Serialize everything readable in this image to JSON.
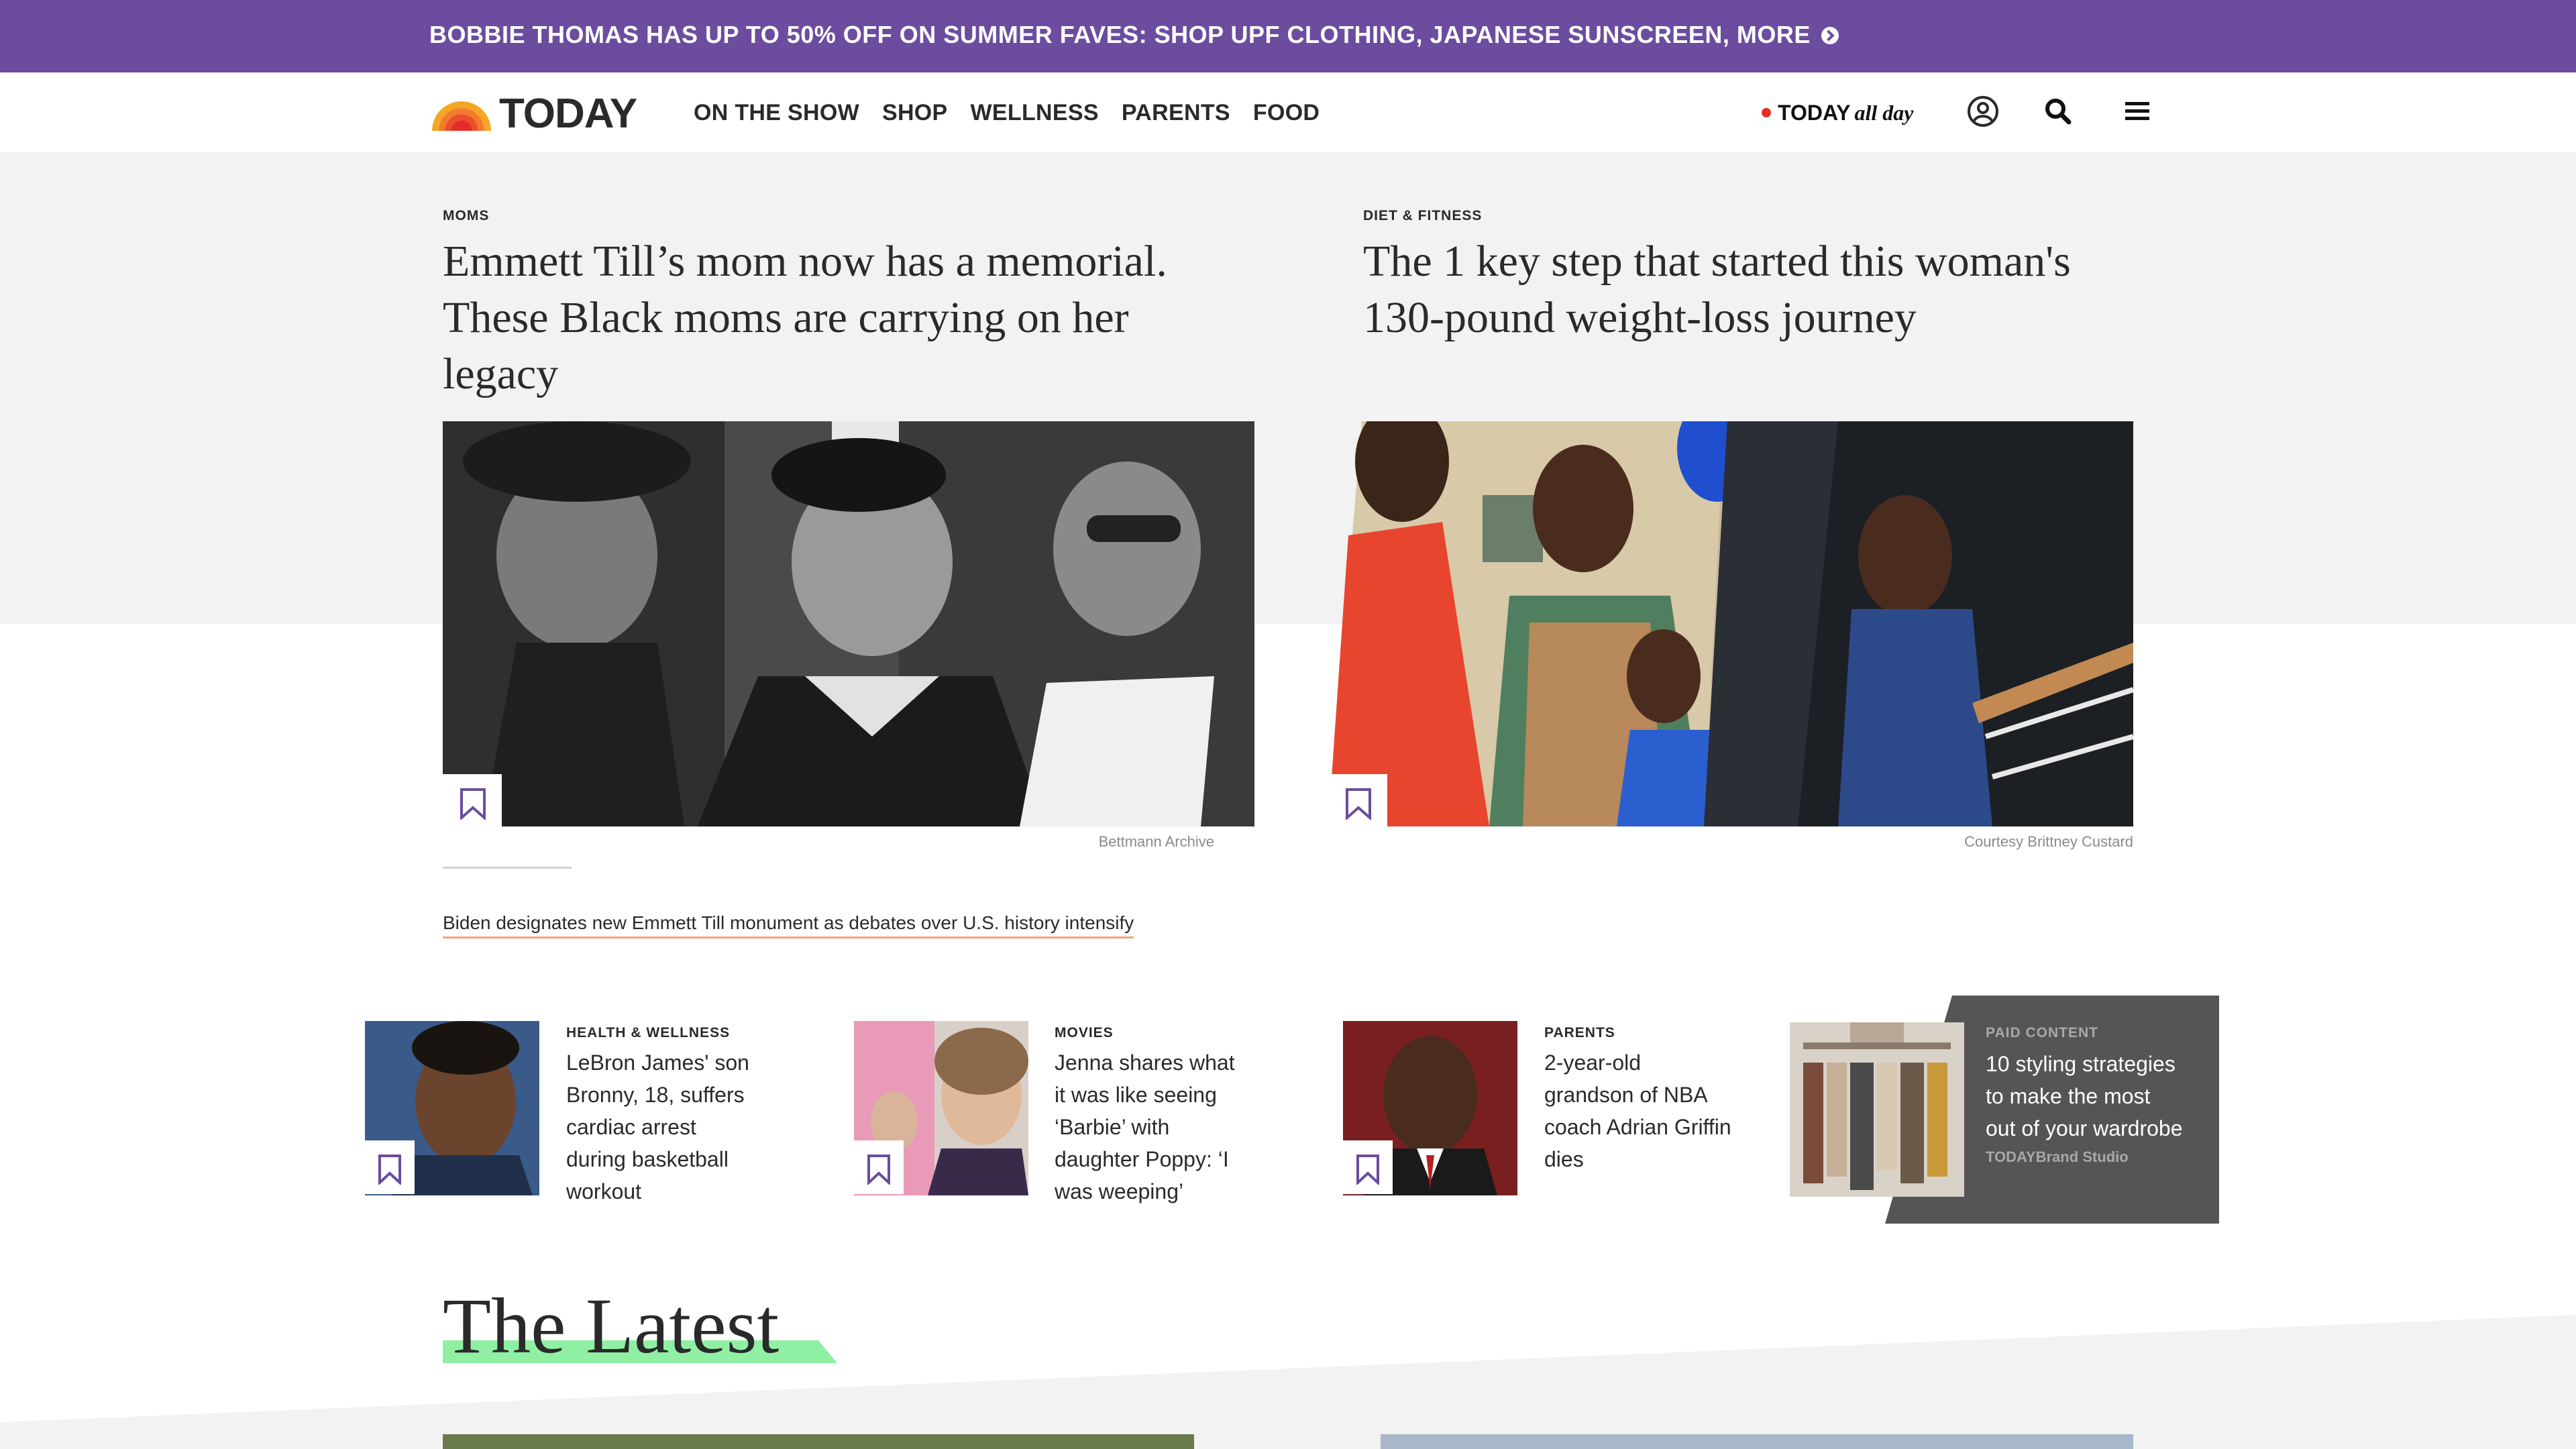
{
  "promo": {
    "text": "BOBBIE THOMAS HAS UP TO 50% OFF ON SUMMER FAVES: SHOP UPF CLOTHING, JAPANESE SUNSCREEN, MORE",
    "arrow_icon": "chevron-right-circle-icon",
    "background_color": "#6b4c9f"
  },
  "nav": {
    "logo_text": "TODAY",
    "links": [
      "ON THE SHOW",
      "SHOP",
      "WELLNESS",
      "PARENTS",
      "FOOD"
    ],
    "allday_today": "TODAY",
    "allday_rest": "all day",
    "icons": [
      "user-account-icon",
      "search-icon",
      "hamburger-menu-icon"
    ]
  },
  "hero": [
    {
      "eyebrow": "MOMS",
      "headline_lines": [
        "Emmett Till’s mom now has a memorial.",
        "These Black moms are carrying on her",
        "legacy"
      ],
      "credit": "Bettmann Archive"
    },
    {
      "eyebrow": "DIET & FITNESS",
      "headline_lines": [
        "The 1 key step that started this woman's",
        "130-pound weight-loss journey"
      ],
      "credit": "Courtesy Brittney Custard"
    }
  ],
  "related_link": "Biden designates new Emmett Till monument as debates over U.S. history intensify",
  "cards": [
    {
      "eyebrow": "HEALTH & WELLNESS",
      "headline_lines": [
        "LeBron James' son",
        "Bronny, 18, suffers",
        "cardiac arrest",
        "during basketball",
        "workout"
      ]
    },
    {
      "eyebrow": "MOVIES",
      "headline_lines": [
        "Jenna shares what",
        "it was like seeing",
        "‘Barbie’ with",
        "daughter Poppy: ‘I",
        "was weeping’"
      ]
    },
    {
      "eyebrow": "PARENTS",
      "headline_lines": [
        "2-year-old",
        "grandson of NBA",
        "coach Adrian Griffin",
        "dies"
      ]
    }
  ],
  "paid_card": {
    "label": "PAID CONTENT",
    "headline_lines": [
      "10 styling strategies",
      "to make the most",
      "out of your wardrobe"
    ],
    "brand": "TODAYBrand Studio"
  },
  "latest": {
    "title": "The Latest",
    "highlight_color": "#8ff0a4"
  },
  "colors": {
    "bookmark": "#6b4c9f",
    "related_underline": "#f5a07a",
    "paid_bg": "#555555",
    "hero_band": "#f2f2f2"
  }
}
